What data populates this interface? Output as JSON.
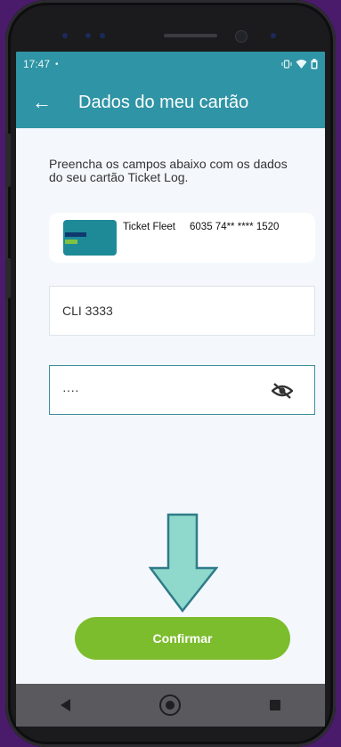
{
  "status_bar": {
    "time": "17:47",
    "dot": "•",
    "icons": [
      "vibrate-icon",
      "wifi-icon",
      "battery-icon"
    ]
  },
  "app_bar": {
    "back_icon": "←",
    "title": "Dados do meu cartão"
  },
  "description": "Preencha os campos abaixo com os dados do seu cartão Ticket Log.",
  "card": {
    "product": "Ticket Fleet",
    "number": "6035 74** **** 1520"
  },
  "form": {
    "field1_value": "CLI 3333",
    "field2_value": "····"
  },
  "confirm_label": "Confirmar",
  "colors": {
    "primary": "#2f94a5",
    "accent_button": "#7cbd2d",
    "arrow_fill": "#8ed8cc",
    "arrow_stroke": "#2f7b88"
  },
  "nav_bar": {
    "items": [
      "back-icon",
      "home-icon",
      "recents-icon"
    ]
  }
}
